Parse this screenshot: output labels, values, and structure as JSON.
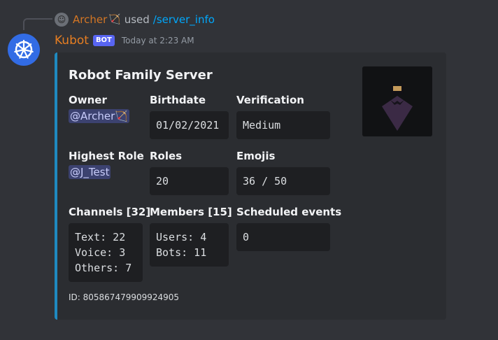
{
  "reply": {
    "username": "Archer",
    "username_emoji": "bow-and-arrow",
    "used_text": "used",
    "command": "/server_info"
  },
  "message": {
    "username": "Kubot",
    "bot_tag": "BOT",
    "timestamp": "Today at 2:23 AM"
  },
  "embed": {
    "title": "Robot Family Server",
    "accent_color": "#1f8ac0",
    "thumbnail": "batman-figure",
    "fields": {
      "owner": {
        "name": "Owner",
        "value": "@Archer"
      },
      "birthdate": {
        "name": "Birthdate",
        "value": "01/02/2021"
      },
      "verification": {
        "name": "Verification",
        "value": "Medium"
      },
      "highest_role": {
        "name": "Highest Role",
        "value": "@J_Test"
      },
      "roles": {
        "name": "Roles",
        "value": "20"
      },
      "emojis": {
        "name": "Emojis",
        "value": "36 / 50"
      },
      "channels": {
        "name": "Channels [32]",
        "value": "Text: 22\nVoice: 3\nOthers: 7"
      },
      "members": {
        "name": "Members [15]",
        "value": "Users: 4\nBots: 11"
      },
      "scheduled": {
        "name": "Scheduled events",
        "value": "0"
      }
    },
    "footer_id": "ID: 805867479909924905"
  },
  "colors": {
    "background": "#313338",
    "embed_bg": "#2b2d31",
    "username": "#e67e22",
    "link": "#00a8fc",
    "bot_tag": "#5865f2"
  }
}
